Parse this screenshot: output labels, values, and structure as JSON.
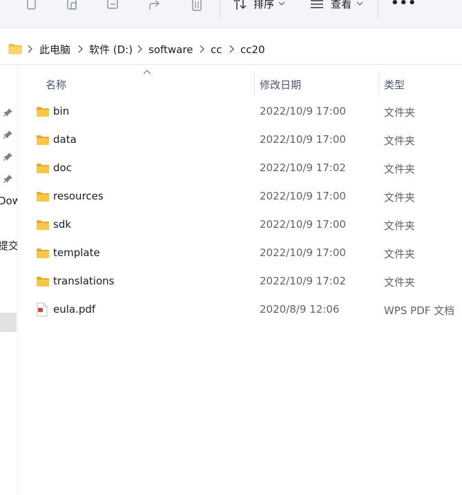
{
  "toolbar": {
    "sort_label": "排序",
    "view_label": "查看",
    "more_label": "•••"
  },
  "breadcrumb": {
    "items": [
      "此电脑",
      "软件 (D:)",
      "software",
      "cc",
      "cc20"
    ]
  },
  "navpane": {
    "fragments": [
      "Dow",
      "提交"
    ]
  },
  "columns": {
    "name": "名称",
    "date": "修改日期",
    "type": "类型"
  },
  "files": [
    {
      "name": "bin",
      "date": "2022/10/9 17:00",
      "type": "文件夹",
      "icon": "folder-icon"
    },
    {
      "name": "data",
      "date": "2022/10/9 17:00",
      "type": "文件夹",
      "icon": "folder-icon"
    },
    {
      "name": "doc",
      "date": "2022/10/9 17:02",
      "type": "文件夹",
      "icon": "folder-icon"
    },
    {
      "name": "resources",
      "date": "2022/10/9 17:00",
      "type": "文件夹",
      "icon": "folder-icon"
    },
    {
      "name": "sdk",
      "date": "2022/10/9 17:00",
      "type": "文件夹",
      "icon": "folder-icon"
    },
    {
      "name": "template",
      "date": "2022/10/9 17:00",
      "type": "文件夹",
      "icon": "folder-icon"
    },
    {
      "name": "translations",
      "date": "2022/10/9 17:02",
      "type": "文件夹",
      "icon": "folder-icon"
    },
    {
      "name": "eula.pdf",
      "date": "2020/8/9 12:06",
      "type": "WPS PDF 文档",
      "icon": "pdf-file-icon"
    }
  ],
  "colors": {
    "folder": "#f7c74a",
    "folder_dark": "#e8a92a",
    "pdf_accent": "#d9433a"
  }
}
